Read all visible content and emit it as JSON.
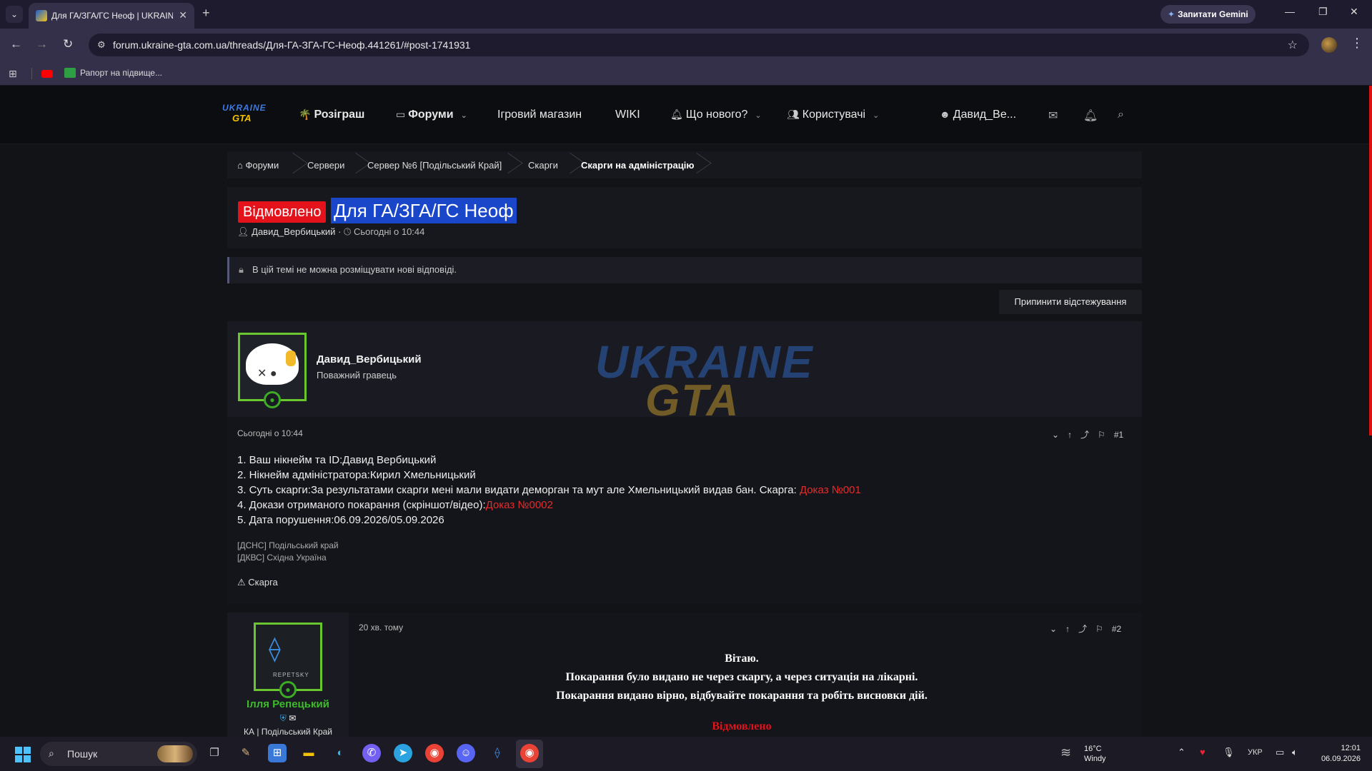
{
  "browser": {
    "tab_title": "Для ГА/ЗГА/ГС Неоф | UKRAINE",
    "gemini_label": "Запитати Gemini",
    "url": "forum.ukraine-gta.com.ua/threads/Для-ГА-ЗГА-ГС-Неоф.441261/#post-1741931",
    "bookmark_label": "Рапорт на підвище..."
  },
  "site": {
    "logo_top": "UKRAINE",
    "logo_bottom": "GTA",
    "nav": {
      "giveaway": "Розіграш",
      "forums": "Форуми",
      "store": "Ігровий магазин",
      "wiki": "WIKI",
      "whats_new": "Що нового?",
      "users": "Користувачі",
      "account": "Давид_Ве..."
    }
  },
  "breadcrumb": [
    "Форуми",
    "Сервери",
    "Сервер №6 [Подільський Край]",
    "Скарги",
    "Скарги на адміністрацію"
  ],
  "thread": {
    "prefix": "Відмовлено",
    "title": "Для ГА/ЗГА/ГС Неоф",
    "author": "Давид_Вербицький",
    "date": "Сьогодні о 10:44",
    "locked_notice": "В цій темі не можна розміщувати нові відповіді.",
    "unwatch_label": "Припинити відстежування"
  },
  "post1": {
    "author": "Давид_Вербицький",
    "user_title": "Поважний гравець",
    "watermark_top": "UKRAINE",
    "watermark_bottom": "GTA",
    "date": "Сьогодні о 10:44",
    "number": "#1",
    "lines": {
      "l1": "1. Ваш нікнейм та ID:Давид Вербицький",
      "l2": "2. Нікнейм адміністратора:Кирил Хмельницький",
      "l3": "3. Суть скарги:За результатами скарги мені мали видати деморган та мут але Хмельницький видав бан. Скарга: ",
      "l3_link": "Доказ №001",
      "l4": "4. Докази отриманого покарання (скріншот/відео):",
      "l4_link": "Доказ №0002",
      "l5": "5. Дата порушення:06.09.2026/05.09.2026"
    },
    "signature": [
      "[ДСНС] Подільський край",
      "[ДКВС] Східна Україна"
    ],
    "report_label": "Скарга"
  },
  "post2": {
    "author": "Ілля Репецький",
    "avatar_label": "REPETSKY",
    "role": "КА | Подільський Край",
    "date": "20 хв. тому",
    "number": "#2",
    "lines": [
      "Вітаю.",
      "Покарання було видано не через скаргу, а через ситуація на лікарні.",
      "Покарання видано вірно, відбувайте покарання та робіть висновки дій."
    ],
    "verdict": "Відмовлено"
  },
  "taskbar": {
    "search_placeholder": "Пошук",
    "weather_temp": "16°C",
    "weather_desc": "Windy",
    "lang": "УКР",
    "time": "12:01",
    "date": "06.09.2026"
  },
  "colors": {
    "denied_red": "#e3121b",
    "title_highlight": "#1a46c9",
    "online_green": "#3cab25",
    "staff_name_green": "#3dbb2a"
  }
}
